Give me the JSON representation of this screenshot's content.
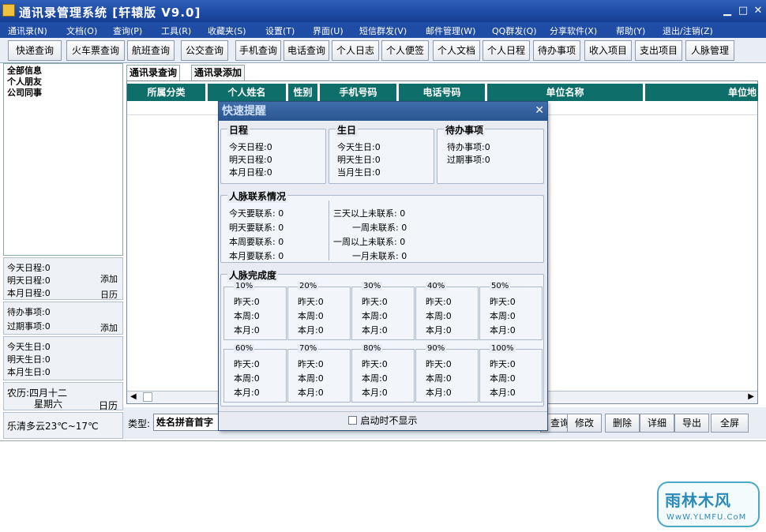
{
  "window": {
    "title": "通讯录管理系统 [轩辕版 V9.0]"
  },
  "menu": [
    "通讯录(N)",
    "文档(O)",
    "查询(P)",
    "工具(R)",
    "收藏夹(S)",
    "设置(T)",
    "界面(U)",
    "短信群发(V)",
    "邮件管理(W)",
    "QQ群发(Q)",
    "分享软件(X)",
    "帮助(Y)",
    "退出/注销(Z)"
  ],
  "toolbar": [
    "快递查询",
    "火车票查询",
    "航班查询",
    "公交查询",
    "手机查询",
    "电话查询",
    "个人日志",
    "个人便签",
    "个人文档",
    "个人日程",
    "待办事项",
    "收入项目",
    "支出项目",
    "人脉管理"
  ],
  "categories": [
    "全部信息",
    "个人朋友",
    "公司同事"
  ],
  "left_info": {
    "schedule": {
      "today": "今天日程:0",
      "tomorrow": "明天日程:0",
      "month": "本月日程:0",
      "add": "添加",
      "calendar": "日历"
    },
    "todo": {
      "pending": "待办事项:0",
      "overdue": "过期事项:0",
      "add": "添加"
    },
    "birthday": {
      "today": "今天生日:0",
      "tomorrow": "明天生日:0",
      "month": "本月生日:0"
    },
    "lunar": {
      "date": "农历:四月十二",
      "weekday": "星期六",
      "calendar": "日历"
    },
    "weather": "乐清多云23℃~17℃"
  },
  "tabs": [
    "通讯录查询",
    "通讯录添加"
  ],
  "grid_headers": [
    "所属分类",
    "个人姓名",
    "性别",
    "手机号码",
    "电话号码",
    "单位名称",
    "单位地"
  ],
  "bottom": {
    "type_label": "类型:",
    "type_value": "姓名拼音首字",
    "buttons": [
      "查询",
      "修改",
      "删除",
      "详细",
      "导出",
      "全屏"
    ]
  },
  "dialog": {
    "title": "快速提醒",
    "schedule": {
      "title": "日程",
      "items": [
        "今天日程:0",
        "明天日程:0",
        "本月日程:0"
      ]
    },
    "birthday": {
      "title": "生日",
      "items": [
        "今天生日:0",
        "明天生日:0",
        "当月生日:0"
      ]
    },
    "todo": {
      "title": "待办事项",
      "items": [
        "待办事项:0",
        "过期事项:0"
      ]
    },
    "contacts": {
      "title": "人脉联系情况",
      "left": [
        "今天要联系: 0",
        "明天要联系: 0",
        "本周要联系: 0",
        "本月要联系: 0"
      ],
      "right": [
        "三天以上未联系: 0",
        "一周未联系: 0",
        "一周以上未联系: 0",
        "一月未联系: 0"
      ]
    },
    "completion": {
      "title": "人脉完成度",
      "boxes": [
        {
          "label": "10%",
          "items": [
            "昨天:0",
            "本周:0",
            "本月:0"
          ]
        },
        {
          "label": "20%",
          "items": [
            "昨天:0",
            "本周:0",
            "本月:0"
          ]
        },
        {
          "label": "30%",
          "items": [
            "昨天:0",
            "本周:0",
            "本月:0"
          ]
        },
        {
          "label": "40%",
          "items": [
            "昨天:0",
            "本周:0",
            "本月:0"
          ]
        },
        {
          "label": "50%",
          "items": [
            "昨天:0",
            "本周:0",
            "本月:0"
          ]
        },
        {
          "label": "60%",
          "items": [
            "昨天:0",
            "本周:0",
            "本月:0"
          ]
        },
        {
          "label": "70%",
          "items": [
            "昨天:0",
            "本周:0",
            "本月:0"
          ]
        },
        {
          "label": "80%",
          "items": [
            "昨天:0",
            "本周:0",
            "本月:0"
          ]
        },
        {
          "label": "90%",
          "items": [
            "昨天:0",
            "本周:0",
            "本月:0"
          ]
        },
        {
          "label": "100%",
          "items": [
            "昨天:0",
            "本周:0",
            "本月:0"
          ]
        }
      ]
    },
    "footer": "启动时不显示"
  },
  "watermark": {
    "name": "雨林木风",
    "url": "WwW.YLMFU.CoM"
  }
}
